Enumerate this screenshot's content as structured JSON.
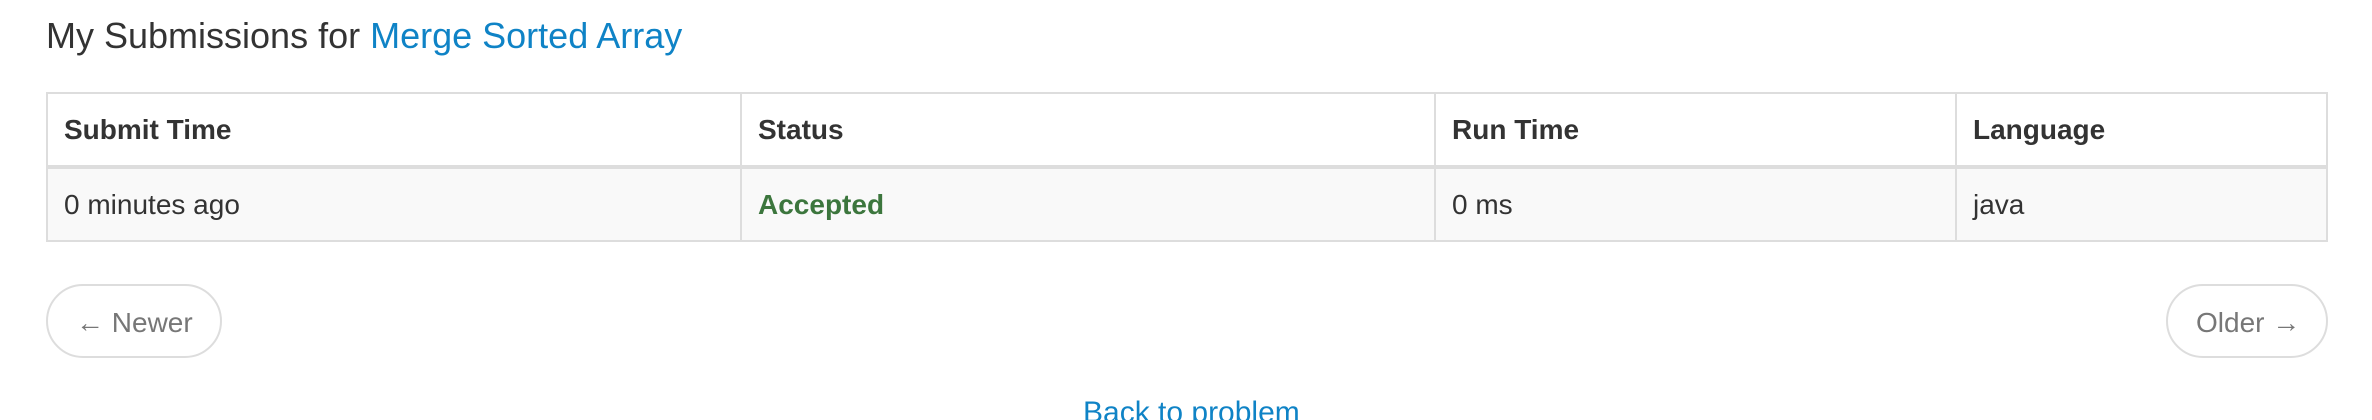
{
  "header": {
    "prefix": "My Submissions for",
    "problem_link": "Merge Sorted Array"
  },
  "table": {
    "columns": [
      "Submit Time",
      "Status",
      "Run Time",
      "Language"
    ],
    "rows": [
      {
        "submit_time": "0 minutes ago",
        "status": "Accepted",
        "run_time": "0 ms",
        "language": "java"
      }
    ]
  },
  "pager": {
    "newer_label": "← Newer",
    "older_label": "Older →"
  },
  "footer": {
    "back_link": "Back to problem"
  },
  "colors": {
    "link": "#0f83c6",
    "accepted": "#3c763d"
  }
}
